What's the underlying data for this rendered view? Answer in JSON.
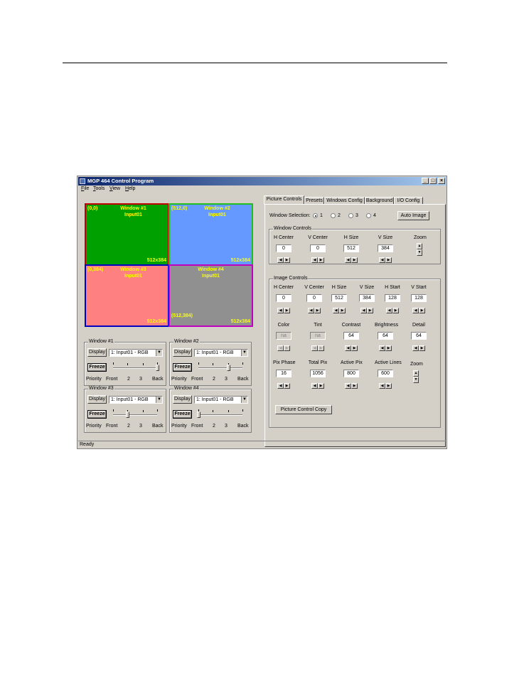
{
  "window": {
    "title": "MGP 464 Control Program",
    "minimize": "_",
    "maximize": "□",
    "close": "×"
  },
  "menu": [
    "File",
    "Tools",
    "View",
    "Help"
  ],
  "preview": {
    "quadrants": [
      {
        "coord": "(0,0)",
        "name": "Window #1",
        "input": "Input01",
        "size": "512x384",
        "fill": "#00a000",
        "border": "#c00000"
      },
      {
        "coord": "(512,0)",
        "name": "Window #2",
        "input": "Input01",
        "size": "512x384",
        "fill": "#6699ff",
        "border": "#20c020"
      },
      {
        "coord": "(0,384)",
        "name": "Window #3",
        "input": "Input01",
        "size": "512x384",
        "fill": "#ff8080",
        "border": "#0000c0"
      },
      {
        "coord": "(512,384)",
        "name": "Window #4",
        "input": "Input01",
        "size": "512x384",
        "fill": "#909090",
        "border": "#c000c0"
      }
    ]
  },
  "window_groups": [
    {
      "label": "Window #1",
      "display": "Display",
      "source": "1: Input01 - RGB",
      "freeze": "Freeze",
      "priority": "Priority",
      "front": "Front",
      "p2": "2",
      "p3": "3",
      "back": "Back",
      "position": 1.0
    },
    {
      "label": "Window #2",
      "display": "Display",
      "source": "1: Input01 - RGB",
      "freeze": "Freeze",
      "priority": "Priority",
      "front": "Front",
      "p2": "2",
      "p3": "3",
      "back": "Back",
      "position": 0.67
    },
    {
      "label": "Window #3",
      "display": "Display",
      "source": "1: Input01 - RGB",
      "freeze": "Freeze",
      "priority": "Priority",
      "front": "Front",
      "p2": "2",
      "p3": "3",
      "back": "Back",
      "position": 0.33
    },
    {
      "label": "Window #4",
      "display": "Display",
      "source": "1: Input01 - RGB",
      "freeze": "Freeze",
      "priority": "Priority",
      "front": "Front",
      "p2": "2",
      "p3": "3",
      "back": "Back",
      "position": 0.0
    }
  ],
  "tabs": [
    "Picture Controls",
    "Presets",
    "Windows Config",
    "Background",
    "I/O Config"
  ],
  "active_tab": "Picture Controls",
  "window_selection": {
    "label": "Window Selection:",
    "options": [
      "1",
      "2",
      "3",
      "4"
    ],
    "selected": "1",
    "auto_image": "Auto Image"
  },
  "window_controls": {
    "label": "Window Controls",
    "fields": [
      {
        "label": "H Center",
        "value": "0"
      },
      {
        "label": "V Center",
        "value": "0"
      },
      {
        "label": "H Size",
        "value": "512"
      },
      {
        "label": "V Size",
        "value": "384"
      }
    ],
    "zoom": "Zoom"
  },
  "image_controls": {
    "label": "Image Controls",
    "row1": [
      {
        "label": "H Center",
        "value": "0"
      },
      {
        "label": "V Center",
        "value": "0"
      },
      {
        "label": "H Size",
        "value": "512"
      },
      {
        "label": "V Size",
        "value": "384"
      },
      {
        "label": "H Start",
        "value": "128"
      },
      {
        "label": "V Start",
        "value": "128"
      }
    ],
    "row2": [
      {
        "label": "Color",
        "value": "na",
        "disabled": true
      },
      {
        "label": "Tint",
        "value": "na",
        "disabled": true
      },
      {
        "label": "Contrast",
        "value": "64"
      },
      {
        "label": "Brightness",
        "value": "64"
      },
      {
        "label": "Detail",
        "value": "64"
      }
    ],
    "row3": [
      {
        "label": "Pix Phase",
        "value": "16"
      },
      {
        "label": "Total Pix",
        "value": "1056"
      },
      {
        "label": "Active Pix",
        "value": "800"
      },
      {
        "label": "Active Lines",
        "value": "600"
      }
    ],
    "zoom": "Zoom",
    "copy_button": "Picture Control Copy"
  },
  "status": "Ready"
}
